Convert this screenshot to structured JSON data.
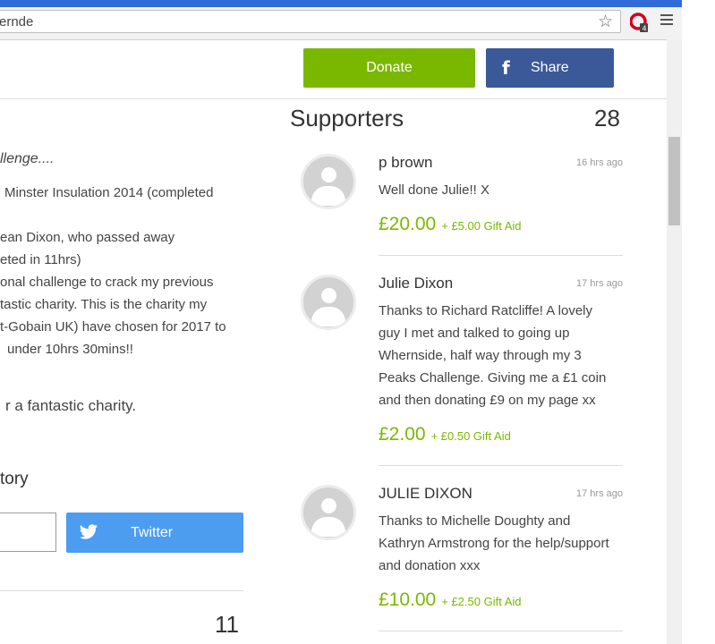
{
  "browser": {
    "url": "ernde"
  },
  "header": {
    "donate_label": "Donate",
    "share_label": "Share",
    "facebook_glyph": "f"
  },
  "story": {
    "lines": [
      "llenge....",
      "Minster Insulation 2014  (completed",
      "ean Dixon, who passed away",
      "eted in 11hrs)",
      "onal challenge to crack my previous",
      "tastic charity. This is the charity my",
      "t-Gobain UK) have chosen for 2017 to",
      "under 10hrs 30mins!!",
      "r a fantastic charity."
    ],
    "heading": "tory",
    "twitter_label": "Twitter",
    "count": "11"
  },
  "supporters": {
    "title": "Supporters",
    "count": "28",
    "items": [
      {
        "name": "p brown",
        "time": "16 hrs ago",
        "message": "Well done Julie!! X",
        "amount": "£20.00",
        "gift_aid": "+ £5.00 Gift Aid"
      },
      {
        "name": "Julie Dixon",
        "time": "17 hrs ago",
        "message": "Thanks to Richard Ratcliffe! A lovely guy I met and talked to going up Whernside, half way through my 3 Peaks Challenge. Giving me a £1 coin and then donating £9 on my page xx",
        "amount": "£2.00",
        "gift_aid": "+ £0.50 Gift Aid"
      },
      {
        "name": "JULIE DIXON",
        "time": "17 hrs ago",
        "message": "Thanks to Michelle Doughty and Kathryn Armstrong for the help/support and donation xxx",
        "amount": "£10.00",
        "gift_aid": "+ £2.50 Gift Aid"
      }
    ]
  },
  "colors": {
    "donate_green": "#7ab800",
    "facebook_blue": "#3b5998",
    "twitter_blue": "#4c9cf0"
  },
  "icons": [
    "star-icon",
    "opera-icon",
    "menu-icon",
    "facebook-icon",
    "twitter-icon",
    "avatar-icon"
  ]
}
